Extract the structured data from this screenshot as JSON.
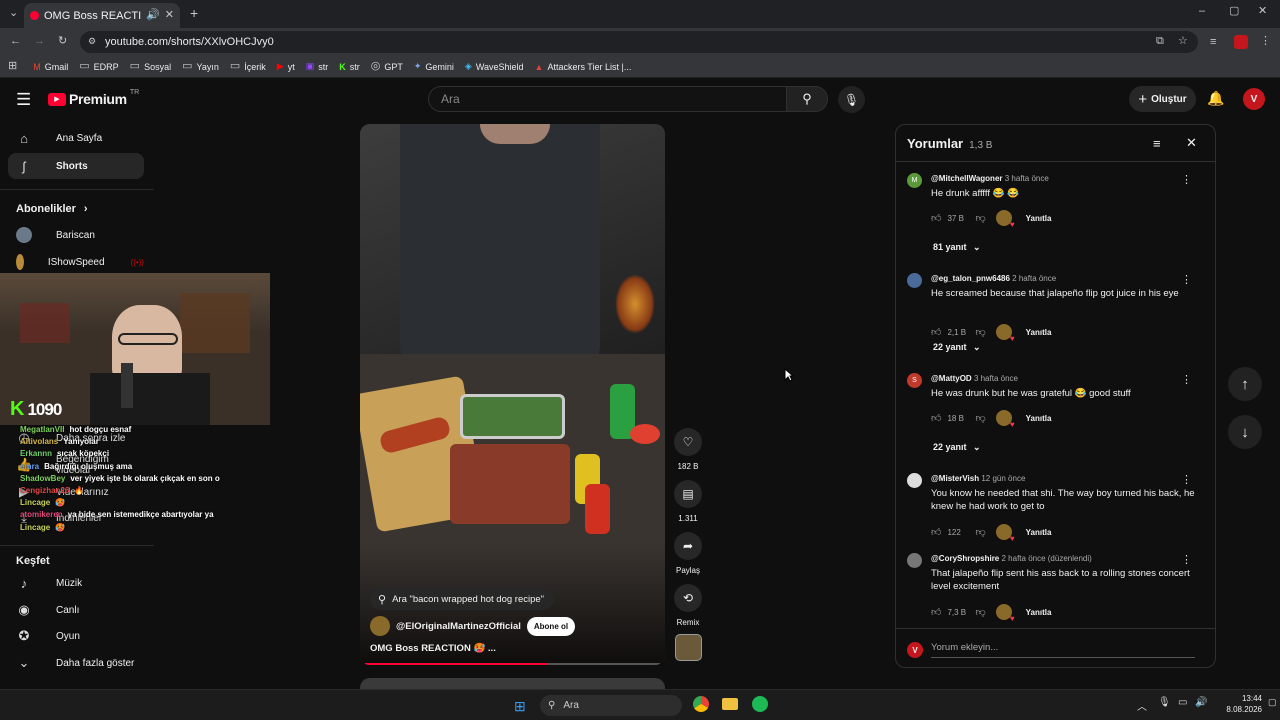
{
  "browser": {
    "tab_title": "OMG Boss REACTION 🥵 #",
    "url": "youtube.com/shorts/XXlvOHCJvy0",
    "bookmarks": [
      "Gmail",
      "EDRP",
      "Sosyal",
      "Yayın",
      "İçerik",
      "yt",
      "str",
      "str",
      "GPT",
      "Gemini",
      "WaveShield",
      "Attackers Tier List |..."
    ]
  },
  "yt": {
    "logo": "Premium",
    "logo_sup": "TR",
    "search_placeholder": "Ara",
    "create_label": "Oluştur"
  },
  "sidebar": {
    "home": "Ana Sayfa",
    "shorts": "Shorts",
    "subs_header": "Abonelikler",
    "sub1": "Bariscan",
    "sub2": "IShowSpeed",
    "watch_later": "Daha sonra izle",
    "liked": "Beğendiğim videolar",
    "your_videos": "Videolarınız",
    "downloads": "İndirilenler",
    "explore_header": "Keşfet",
    "music": "Müzik",
    "live": "Canlı",
    "gaming": "Oyun",
    "show_more": "Daha fazla göster"
  },
  "overlay": {
    "counter": "1090",
    "chat": [
      {
        "user": "MegatlanVII",
        "msg": "hot dogçu esnaf",
        "color": "#7fd35a"
      },
      {
        "user": "Altivolans",
        "msg": "Yanıyolar",
        "color": "#d8b84c"
      },
      {
        "user": "Erkannn",
        "msg": "sıcak köpekçi",
        "color": "#6fd06a"
      },
      {
        "user": "emra",
        "msg": "Bağırdığı oluşmuş ama",
        "color": "#6a9ef0"
      },
      {
        "user": "ShadowBey",
        "msg": "ver yiyek işte bk olarak çıkçak en son o",
        "color": "#7cd05a"
      },
      {
        "user": "Cengizhan26",
        "msg": "🔥",
        "color": "#e04a4a"
      },
      {
        "user": "Lincage",
        "msg": "🥵",
        "color": "#c9d55a"
      },
      {
        "user": "atomikeren",
        "msg": "ya bide sen istemedikçe abartıyolar ya",
        "color": "#e04a7a"
      },
      {
        "user": "Lincage",
        "msg": "🥵",
        "color": "#c9d55a"
      }
    ]
  },
  "short": {
    "search_chip": "Ara \"bacon wrapped hot dog recipe\"",
    "channel": "@ElOriginalMartinezOfficial",
    "subscribe": "Abone ol",
    "title": "OMG Boss REACTION 🥵 ...",
    "likes": "182 B",
    "comments": "1.311",
    "share": "Paylaş",
    "remix": "Remix",
    "progress": 0.62
  },
  "comments": {
    "title": "Yorumlar",
    "count": "1,3 B",
    "reply_label": "Yanıtla",
    "add_placeholder": "Yorum ekleyin...",
    "items": [
      {
        "initial": "M",
        "color": "#5a9a3a",
        "author": "@MitchellWagoner",
        "time": "3 hafta önce",
        "text": "He drunk afffff 😂 😂",
        "likes": "37 B",
        "replies": "81 yanıt"
      },
      {
        "initial": "",
        "color": "#4a6a9a",
        "author": "@eg_talon_pnw6486",
        "time": "2 hafta önce",
        "text": "He screamed because that jalapeño flip got juice in his eye",
        "likes": "2,1 B",
        "replies": "22 yanıt"
      },
      {
        "initial": "S",
        "color": "#c0392b",
        "author": "@MattyOD",
        "time": "3 hafta önce",
        "text": "He was drunk but he was grateful 😂 good stuff",
        "likes": "18 B",
        "replies": "22 yanıt"
      },
      {
        "initial": "",
        "color": "#ddd",
        "author": "@MisterVish",
        "time": "12 gün önce",
        "text": "You know he needed that shi. The way boy turned his back, he knew he had work to get to",
        "likes": "122",
        "replies": ""
      },
      {
        "initial": "",
        "color": "#777",
        "author": "@CoryShropshire",
        "time": "2 hafta önce (düzenlendi)",
        "text": "That jalapeño flip sent his ass back to a rolling stones concert level excitement",
        "likes": "7,3 B",
        "replies": ""
      }
    ]
  },
  "taskbar": {
    "search": "Ara",
    "time": "13:44",
    "date": "8.08.2026"
  }
}
